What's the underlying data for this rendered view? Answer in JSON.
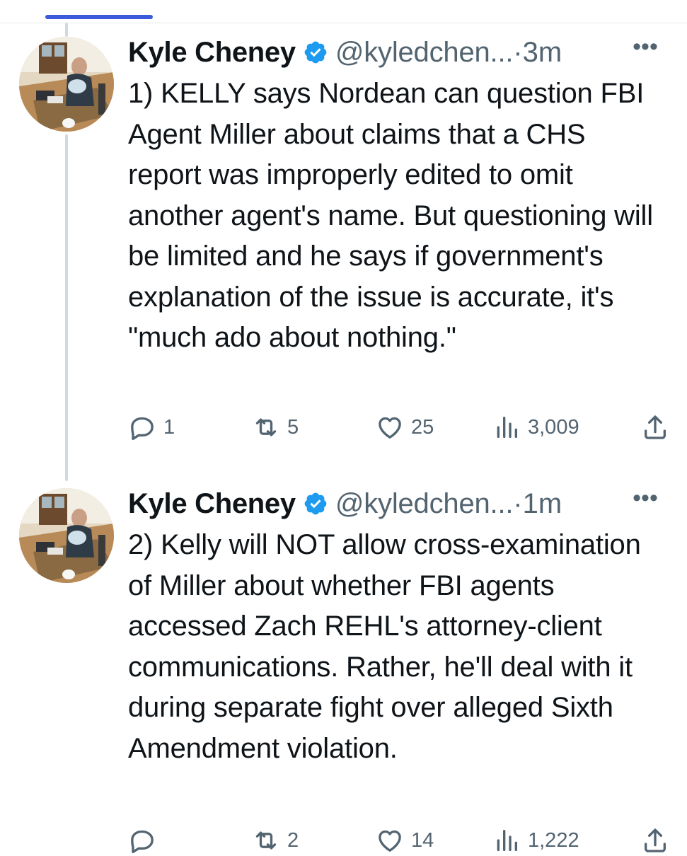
{
  "tweets": [
    {
      "author": {
        "name": "Kyle Cheney",
        "handle": "@kyledchen...",
        "verified": true
      },
      "time": "3m",
      "text": "1) KELLY says Nordean can question FBI Agent Miller about claims that a CHS report was improperly edited to omit another agent's name. But questioning will be limited and he says if government's explanation of the issue is accurate, it's \"much ado about nothing.\"",
      "stats": {
        "replies": "1",
        "reposts": "5",
        "likes": "25",
        "views": "3,009"
      }
    },
    {
      "author": {
        "name": "Kyle Cheney",
        "handle": "@kyledchen...",
        "verified": true
      },
      "time": "1m",
      "text": "2) Kelly will NOT allow cross-examination of Miller about whether FBI agents accessed Zach REHL's attorney-client communications. Rather, he'll deal with it during separate fight over alleged Sixth Amendment violation.",
      "stats": {
        "replies": "",
        "reposts": "2",
        "likes": "14",
        "views": "1,222"
      }
    }
  ],
  "ui": {
    "separator_dot": "·",
    "more_glyph": "•••"
  },
  "colors": {
    "verified": "#1d9bf0",
    "secondary_text": "#536471",
    "thread_line": "#cfd9de",
    "tab_indicator": "#3b5bdb"
  },
  "icons": [
    "reply-icon",
    "repost-icon",
    "like-icon",
    "views-icon",
    "share-icon",
    "verified-badge-icon",
    "more-icon"
  ]
}
